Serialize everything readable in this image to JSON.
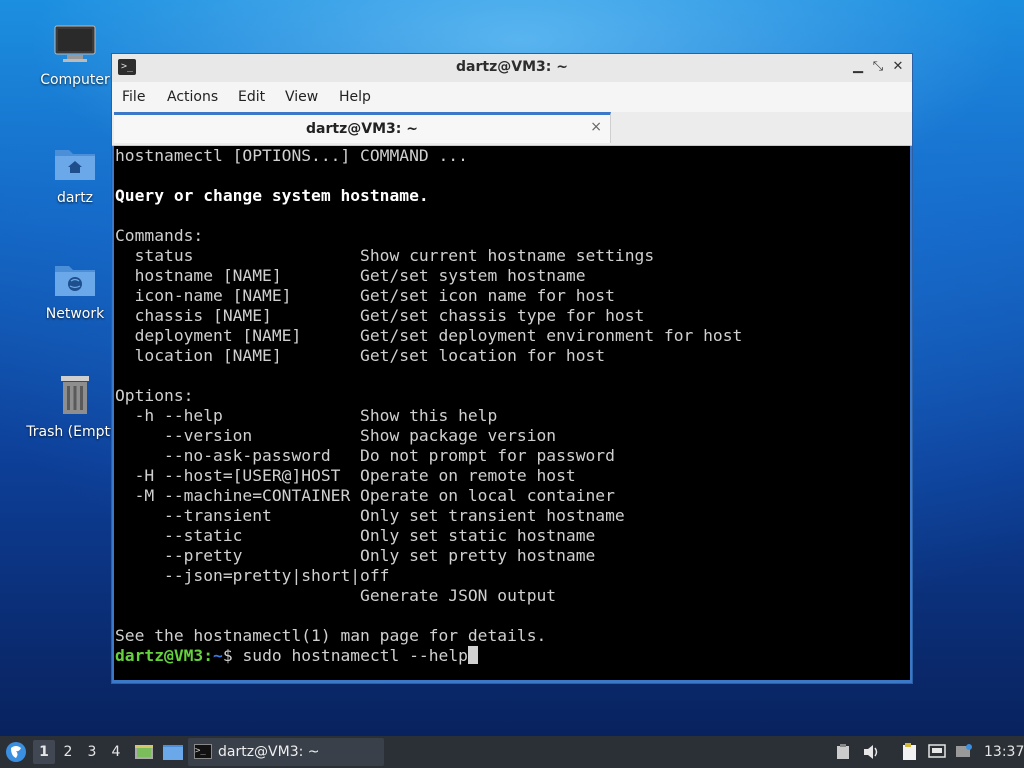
{
  "desktop": {
    "icons": [
      {
        "label": "Computer"
      },
      {
        "label": "dartz"
      },
      {
        "label": "Network"
      },
      {
        "label": "Trash (Empty)"
      }
    ]
  },
  "window": {
    "title": "dartz@VM3: ~",
    "menu": [
      "File",
      "Actions",
      "Edit",
      "View",
      "Help"
    ],
    "tab_label": "dartz@VM3: ~",
    "tab_close": "×",
    "controls": {
      "minimize": "▁",
      "maximize": "⤡",
      "close": "✕"
    }
  },
  "terminal": {
    "lines": [
      "hostnamectl [OPTIONS...] COMMAND ...",
      "",
      "Query or change system hostname.",
      "",
      "Commands:",
      "  status                 Show current hostname settings",
      "  hostname [NAME]        Get/set system hostname",
      "  icon-name [NAME]       Get/set icon name for host",
      "  chassis [NAME]         Get/set chassis type for host",
      "  deployment [NAME]      Get/set deployment environment for host",
      "  location [NAME]        Get/set location for host",
      "",
      "Options:",
      "  -h --help              Show this help",
      "     --version           Show package version",
      "     --no-ask-password   Do not prompt for password",
      "  -H --host=[USER@]HOST  Operate on remote host",
      "  -M --machine=CONTAINER Operate on local container",
      "     --transient         Only set transient hostname",
      "     --static            Only set static hostname",
      "     --pretty            Only set pretty hostname",
      "     --json=pretty|short|off",
      "                         Generate JSON output",
      "",
      "See the hostnamectl(1) man page for details."
    ],
    "prompt_user": "dartz@VM3",
    "prompt_sep": ":",
    "prompt_path": "~",
    "prompt_symbol": "$ ",
    "command": "sudo hostnamectl --help"
  },
  "taskbar": {
    "workspaces": [
      "1",
      "2",
      "3",
      "4"
    ],
    "active_workspace": "1",
    "task_label": "dartz@VM3: ~",
    "clock": "13:37"
  },
  "colors": {
    "accent": "#3b78c8",
    "prompt_user": "#64d23c",
    "prompt_path": "#3a7ae0",
    "terminal_bg": "#000000",
    "taskbar_bg": "#2b2f36"
  }
}
